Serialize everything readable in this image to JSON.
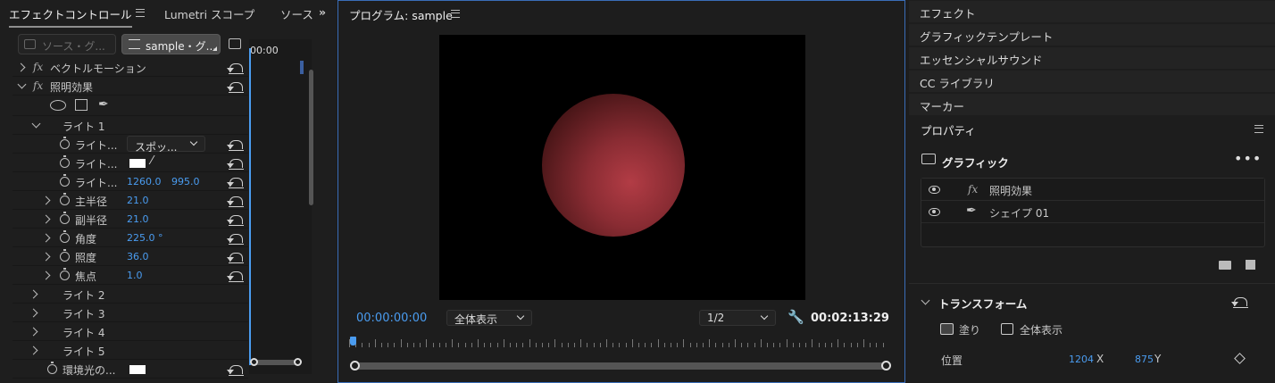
{
  "left_panel": {
    "tabs": {
      "effect_controls": "エフェクトコントロール",
      "lumetri": "Lumetri スコープ",
      "source": "ソース"
    },
    "source_btn": "ソース・グ...",
    "sequence_btn": "sample・グ...",
    "timecode": "00:00",
    "effects": [
      {
        "label": "ベクトルモーション"
      },
      {
        "label": "照明効果"
      }
    ],
    "light1": "ライト 1",
    "params": {
      "light_type": {
        "label": "ライト...",
        "value": "スポッ..."
      },
      "light_color": {
        "label": "ライト..."
      },
      "light_center": {
        "label": "ライト...",
        "x": "1260.0",
        "y": "995.0"
      },
      "major_radius": {
        "label": "主半径",
        "value": "21.0"
      },
      "minor_radius": {
        "label": "副半径",
        "value": "21.0"
      },
      "angle": {
        "label": "角度",
        "value": "225.0 °"
      },
      "intensity": {
        "label": "照度",
        "value": "36.0"
      },
      "focus": {
        "label": "焦点",
        "value": "1.0"
      }
    },
    "lights": [
      "ライト 2",
      "ライト 3",
      "ライト 4",
      "ライト 5"
    ],
    "ambient": "環境光の..."
  },
  "program": {
    "title": "プログラム: sample",
    "timecode_current": "00:00:00:00",
    "zoom": "全体表示",
    "resolution": "1/2",
    "timecode_duration": "00:02:13:29"
  },
  "right_panel": {
    "panels": [
      "エフェクト",
      "グラフィックテンプレート",
      "エッセンシャルサウンド",
      "CC ライブラリ",
      "マーカー"
    ],
    "properties_title": "プロパティ",
    "graphic_title": "グラフィック",
    "layers": [
      {
        "icon": "fx",
        "label": "照明効果"
      },
      {
        "icon": "pen",
        "label": "シェイプ 01"
      }
    ],
    "transform_title": "トランスフォーム",
    "fill_label": "塗り",
    "fit_label": "全体表示",
    "position_label": "位置",
    "position_x": "1204",
    "position_x_unit": "X",
    "position_y": "875",
    "position_y_unit": "Y"
  },
  "colors": {
    "accent": "#4a9cf0",
    "panel_border": "#3a6db8",
    "sphere": "#b23c45"
  }
}
